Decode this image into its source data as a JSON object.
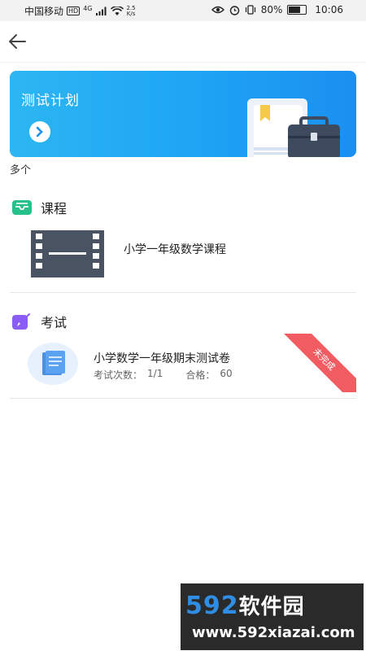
{
  "status_bar": {
    "carrier": "中国移动",
    "hd_badge": "HD",
    "network": "4G",
    "speed_value": "2.5",
    "speed_unit": "K/s",
    "battery": "80%",
    "time": "10:06",
    "battery_level": 0.8
  },
  "banner": {
    "title": "测试计划"
  },
  "plan_count": "多个",
  "course_section": {
    "title": "课程",
    "item": {
      "name": "小学一年级数学课程"
    }
  },
  "exam_section": {
    "title": "考试",
    "item": {
      "name": "小学数学一年级期末测试卷",
      "attempts_label": "考试次数：",
      "attempts_value": "1/1",
      "pass_label": "合格：",
      "pass_value": "60",
      "status": "未完成"
    }
  },
  "watermark": {
    "brand_num": "592",
    "brand_cn": "软件园",
    "url": "www.592xiazai.com"
  },
  "colors": {
    "banner_start": "#2cb6f2",
    "banner_end": "#1b8ff0",
    "course_icon": "#27c28a",
    "exam_icon": "#8b5cf6",
    "ribbon": "#f15b62"
  }
}
